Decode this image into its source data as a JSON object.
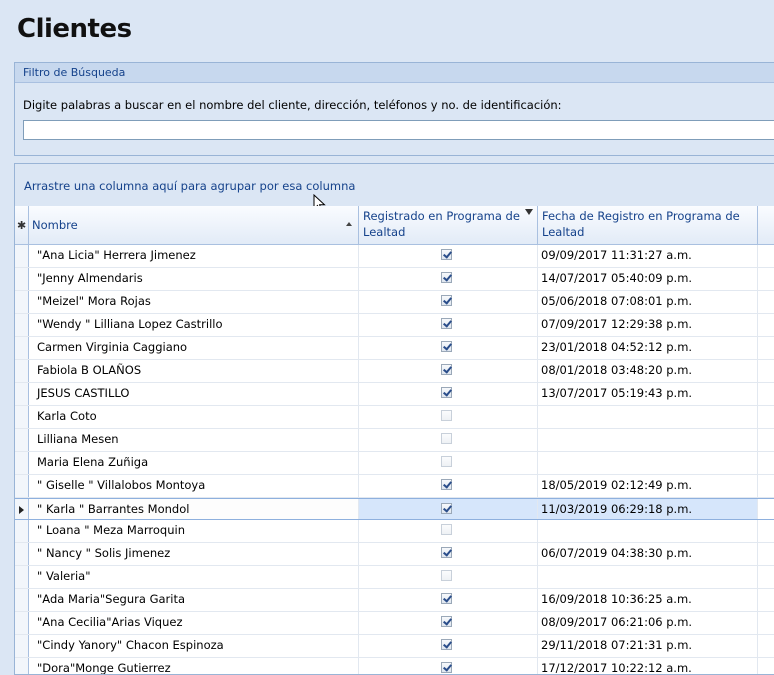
{
  "page": {
    "title": "Clientes"
  },
  "filter": {
    "header": "Filtro de Búsqueda",
    "hint": "Digite palabras a buscar en el nombre del cliente, dirección, teléfonos y no. de identificación:",
    "value": ""
  },
  "grid": {
    "group_hint": "Arrastre una columna aquí para agrupar por esa columna",
    "columns": {
      "name": "Nombre",
      "registered": "Registrado en Programa de Lealtad",
      "date": "Fecha de Registro en Programa de Lealtad"
    },
    "rows": [
      {
        "name": "\"Ana Licia\" Herrera  Jimenez",
        "registered": true,
        "date": "09/09/2017 11:31:27 a.m."
      },
      {
        "name": "\"Jenny Almendaris",
        "registered": true,
        "date": "14/07/2017 05:40:09 p.m."
      },
      {
        "name": "\"Meizel\" Mora Rojas",
        "registered": true,
        "date": "05/06/2018 07:08:01 p.m."
      },
      {
        "name": "\"Wendy \" Lilliana  Lopez  Castrillo",
        "registered": true,
        "date": "07/09/2017 12:29:38 p.m."
      },
      {
        "name": "Carmen Virginia  Caggiano",
        "registered": true,
        "date": "23/01/2018 04:52:12 p.m."
      },
      {
        "name": "Fabiola B OLAÑOS",
        "registered": true,
        "date": "08/01/2018 03:48:20 p.m."
      },
      {
        "name": "JESUS CASTILLO",
        "registered": true,
        "date": "13/07/2017 05:19:43 p.m."
      },
      {
        "name": "Karla Coto",
        "registered": false,
        "date": ""
      },
      {
        "name": "Lilliana Mesen",
        "registered": false,
        "date": ""
      },
      {
        "name": "Maria Elena Zuñiga",
        "registered": false,
        "date": ""
      },
      {
        "name": "\" Giselle \" Villalobos Montoya",
        "registered": true,
        "date": "18/05/2019 02:12:49 p.m."
      },
      {
        "name": "\" Karla \"  Barrantes  Mondol",
        "registered": true,
        "date": "11/03/2019 06:29:18 p.m.",
        "selected": true
      },
      {
        "name": "\" Loana \" Meza Marroquin",
        "registered": false,
        "date": ""
      },
      {
        "name": "\" Nancy \" Solis Jimenez",
        "registered": true,
        "date": "06/07/2019 04:38:30 p.m."
      },
      {
        "name": "\" Valeria\"",
        "registered": false,
        "date": ""
      },
      {
        "name": "\"Ada Maria\"Segura Garita",
        "registered": true,
        "date": "16/09/2018 10:36:25 a.m."
      },
      {
        "name": "\"Ana Cecilia\"Arias Viquez",
        "registered": true,
        "date": "08/09/2017 06:21:06 p.m."
      },
      {
        "name": "\"Cindy Yanory\" Chacon Espinoza",
        "registered": true,
        "date": "29/11/2018 07:21:31 p.m."
      },
      {
        "name": "\"Dora\"Monge Gutierrez",
        "registered": true,
        "date": "17/12/2017 10:22:12 a.m."
      }
    ]
  }
}
